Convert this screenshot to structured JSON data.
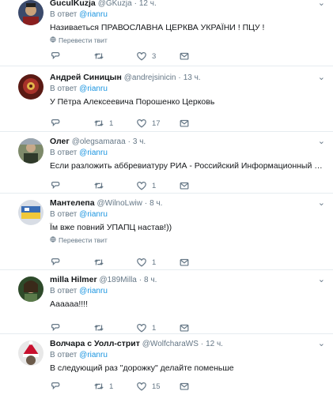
{
  "reply_prefix": "В ответ",
  "translate_label": "Перевести твит",
  "tweets": [
    {
      "name": "GuculKuzja",
      "handle": "@GKuzja",
      "time": "12 ч.",
      "reply_to": "@rianru",
      "text": "Називаеться ПРАВОСЛАВНА ЦЕРКВА УКРАЇНИ ! ПЦУ !",
      "translate": true,
      "replies": "",
      "retweets": "",
      "likes": "3"
    },
    {
      "name": "Андрей Синицын",
      "handle": "@andrejsinicin",
      "time": "13 ч.",
      "reply_to": "@rianru",
      "text": "У Пётра Алексеевича Порошенко Церковь",
      "translate": false,
      "replies": "",
      "retweets": "1",
      "likes": "17"
    },
    {
      "name": "Олег",
      "handle": "@olegsamaraa",
      "time": "3 ч.",
      "reply_to": "@rianru",
      "text": "Если разложить аббревиатуру РИА - Российский Информационный Абсурд...",
      "translate": false,
      "replies": "",
      "retweets": "",
      "likes": "1"
    },
    {
      "name": "Мантелепа",
      "handle": "@WilnoLwiw",
      "time": "8 ч.",
      "reply_to": "@rianru",
      "text": "Їм вже повний УПАПЦ настав!))",
      "translate": true,
      "replies": "",
      "retweets": "",
      "likes": "1"
    },
    {
      "name": "milla Hilmer",
      "handle": "@189Milla",
      "time": "8 ч.",
      "reply_to": "@rianru",
      "text": "Аааааа!!!!",
      "translate": false,
      "replies": "",
      "retweets": "",
      "likes": "1"
    },
    {
      "name": "Волчара с Уолл-стрит",
      "handle": "@WolfcharaWS",
      "time": "12 ч.",
      "reply_to": "@rianru",
      "text": "В следующий раз \"дорожку\" делайте поменьше",
      "translate": false,
      "replies": "",
      "retweets": "1",
      "likes": "15"
    }
  ]
}
